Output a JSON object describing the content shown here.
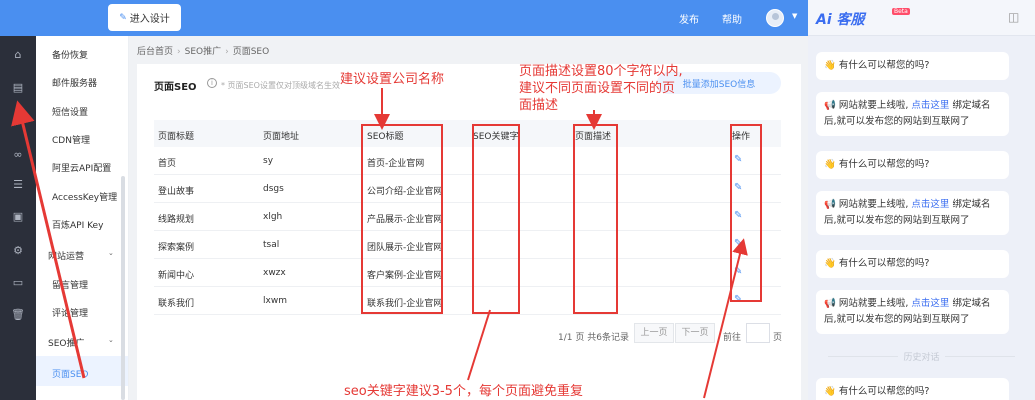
{
  "topbar": {
    "enter_design": "进入设计",
    "nav": [
      "发布",
      "帮助"
    ],
    "colors": {
      "primary": "#4a8ff0"
    }
  },
  "rail": {
    "icons": [
      "home-icon",
      "document-icon",
      "globe-icon",
      "link-icon",
      "list-icon",
      "shop-icon",
      "gear-icon",
      "terminal-icon",
      "trash-icon"
    ]
  },
  "submenu": {
    "items": [
      "备份恢复",
      "邮件服务器",
      "短信设置",
      "CDN管理",
      "阿里云API配置",
      "AccessKey管理",
      "百炼API Key"
    ],
    "group_site": "网站运营",
    "group_site_items": [
      "留言管理",
      "评论管理"
    ],
    "group_seo": "SEO推广",
    "active": "页面SEO"
  },
  "breadcrumb": [
    "后台首页",
    "SEO推广",
    "页面SEO"
  ],
  "card": {
    "title": "页面SEO",
    "hint": "* 页面SEO设置仅对顶级域名生效",
    "batch_button": "批量添加SEO信息"
  },
  "table": {
    "headers": [
      "页面标题",
      "页面地址",
      "SEO标题",
      "SEO关键字",
      "页面描述",
      "操作"
    ],
    "rows": [
      {
        "title": "首页",
        "url": "sy",
        "seo_title": "首页-企业官网",
        "keywords": "",
        "desc": ""
      },
      {
        "title": "登山故事",
        "url": "dsgs",
        "seo_title": "公司介绍-企业官网",
        "keywords": "",
        "desc": ""
      },
      {
        "title": "线路规划",
        "url": "xlgh",
        "seo_title": "产品展示-企业官网",
        "keywords": "",
        "desc": ""
      },
      {
        "title": "探索案例",
        "url": "tsal",
        "seo_title": "团队展示-企业官网",
        "keywords": "",
        "desc": ""
      },
      {
        "title": "新闻中心",
        "url": "xwzx",
        "seo_title": "客户案例-企业官网",
        "keywords": "",
        "desc": ""
      },
      {
        "title": "联系我们",
        "url": "lxwm",
        "seo_title": "联系我们-企业官网",
        "keywords": "",
        "desc": ""
      }
    ]
  },
  "pager": {
    "page_info_1": "1",
    "page_info_2": "/1 页 共6条记录",
    "prev": "上一页",
    "next": "下一页",
    "goto": "前往",
    "page_unit": "页"
  },
  "chat": {
    "logo": "Ai 客服",
    "beta": "Beta",
    "q": "有什么可以帮您的吗?",
    "a_part1": "网站就要上线啦,",
    "a_link": "点击这里",
    "a_part2": "绑定域名后,就可以发布您的网站到互联网了",
    "history": "历史对话",
    "colors": {
      "link": "#3a6df0"
    }
  },
  "annotations": {
    "company": "建议设置公司名称",
    "desc_line1": "页面描述设置80个字符以内,",
    "desc_line2": "建议不同页面设置不同的页",
    "desc_line3": "面描述",
    "keywords": "seo关键字建议3-5个，每个页面避免重复",
    "color": "#e53935"
  }
}
